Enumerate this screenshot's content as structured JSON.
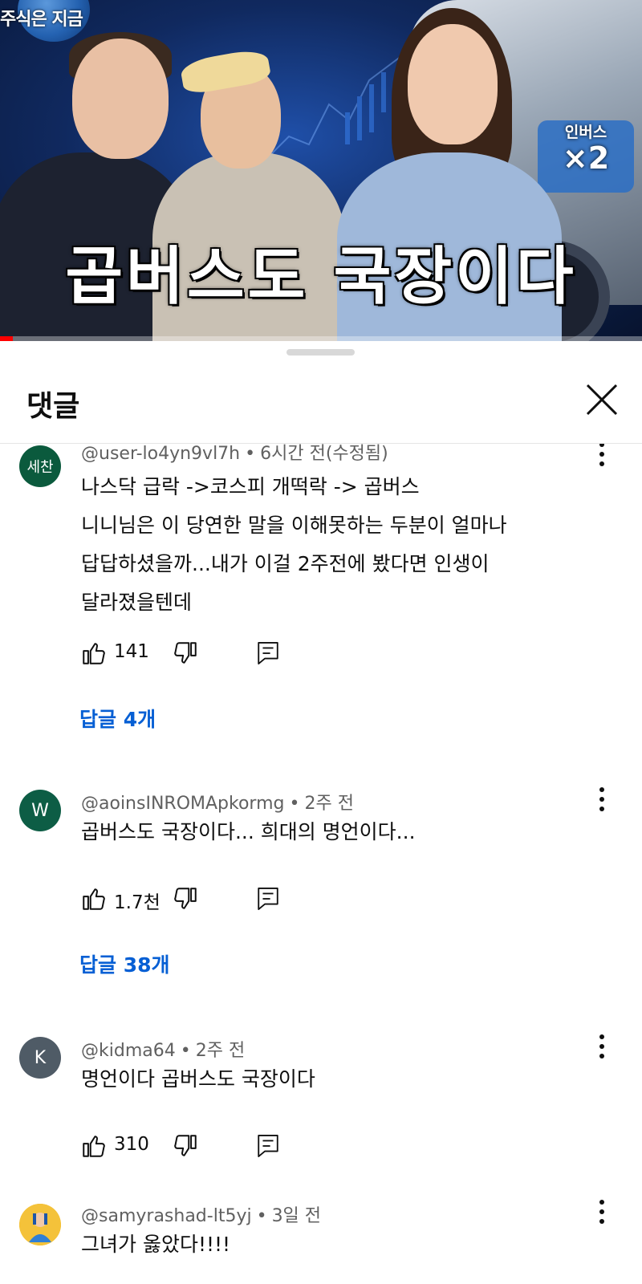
{
  "video": {
    "channel_logo": "주식은 지금",
    "badge_line1": "인버스",
    "badge_line2": "×2",
    "title": "곱버스도 국장이다",
    "progress_fraction": 0.02
  },
  "sheet": {
    "title": "댓글",
    "close_icon": "close-icon"
  },
  "comments": [
    {
      "avatar_text": "세찬",
      "avatar_color": "#0b5a3d",
      "handle": "@user-lo4yn9vl7h",
      "time": "6시간 전(수정됨)",
      "lines": [
        "나스닥 급락 ->코스피 개떡락 -> 곱버스",
        "니니님은 이 당연한 말을 이해못하는 두분이 얼마나",
        "답답하셨을까...내가 이걸 2주전에 봤다면 인생이",
        "달라졌을텐데"
      ],
      "likes": "141",
      "replies": "답글 4개"
    },
    {
      "avatar_text": "W",
      "avatar_color": "#0d5d45",
      "handle": "@aoinsINROMApkormg",
      "time": "2주 전",
      "lines": [
        "곱버스도 국장이다... 희대의 명언이다..."
      ],
      "likes": "1.7천",
      "replies": "답글 38개"
    },
    {
      "avatar_text": "K",
      "avatar_color": "#4f5b66",
      "handle": "@kidma64",
      "time": "2주 전",
      "lines": [
        "명언이다 곱버스도 국장이다"
      ],
      "likes": "310",
      "replies": ""
    },
    {
      "avatar_text": "",
      "avatar_color": "#f4b400",
      "handle": "@samyrashad-lt5yj",
      "time": "3일 전",
      "lines": [
        "그녀가 옳았다!!!!"
      ],
      "likes": "",
      "replies": ""
    }
  ],
  "icons": {
    "like": "thumbs-up-icon",
    "dislike": "thumbs-down-icon",
    "reply": "reply-icon",
    "more": "more-vertical-icon"
  }
}
